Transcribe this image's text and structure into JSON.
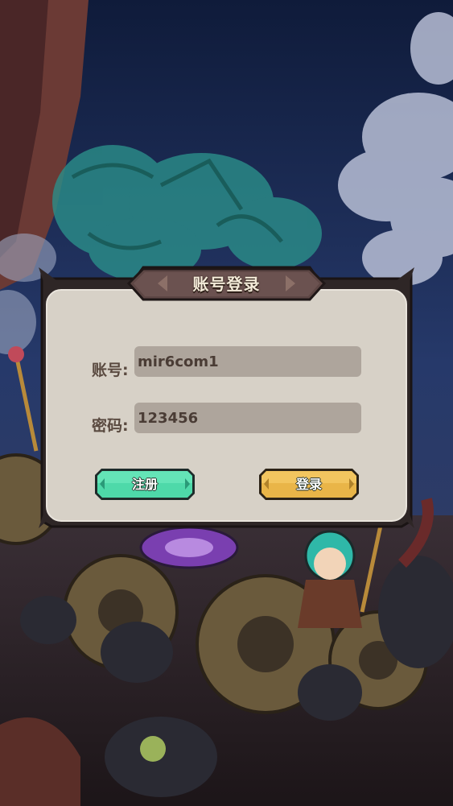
{
  "dialog": {
    "title": "账号登录"
  },
  "account": {
    "label": "账号:",
    "value": "mir6com1"
  },
  "password": {
    "label": "密码:",
    "value": "123456"
  },
  "buttons": {
    "register_label": "注册",
    "login_label": "登录"
  },
  "colors": {
    "panel_bg": "#d7d1c7",
    "panel_border": "#2e2626",
    "input_bg": "#aea59c",
    "register_green": "#4ed9a9",
    "login_gold": "#e9b548"
  }
}
